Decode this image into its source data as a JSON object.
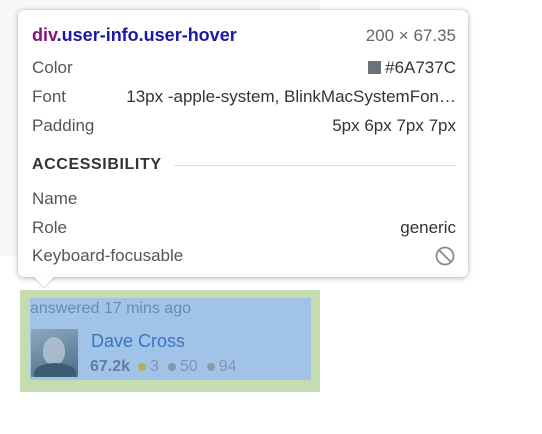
{
  "tooltip": {
    "selector_tag": "div",
    "selector_classes": ".user-info.user-hover",
    "dimensions": "200 × 67.35",
    "color_label": "Color",
    "color_value": "#6A737C",
    "swatch_color": "#6A737C",
    "font_label": "Font",
    "font_value": "13px -apple-system, BlinkMacSystemFon…",
    "padding_label": "Padding",
    "padding_value": "5px 6px 7px 7px",
    "accessibility_heading": "ACCESSIBILITY",
    "name_label": "Name",
    "role_label": "Role",
    "role_value": "generic",
    "focusable_label": "Keyboard-focusable",
    "focusable_icon": "not-allowed-icon"
  },
  "user_card": {
    "answered_text": "answered 17 mins ago",
    "username": "Dave Cross",
    "reputation": "67.2k",
    "gold_badges": "3",
    "silver_badges": "50",
    "bronze_badges": "94"
  },
  "colors": {
    "content_highlight": "#a1c3e8",
    "margin_highlight": "#c4dcb0",
    "selector_tag": "#881280",
    "selector_class": "#1a1aa6"
  }
}
